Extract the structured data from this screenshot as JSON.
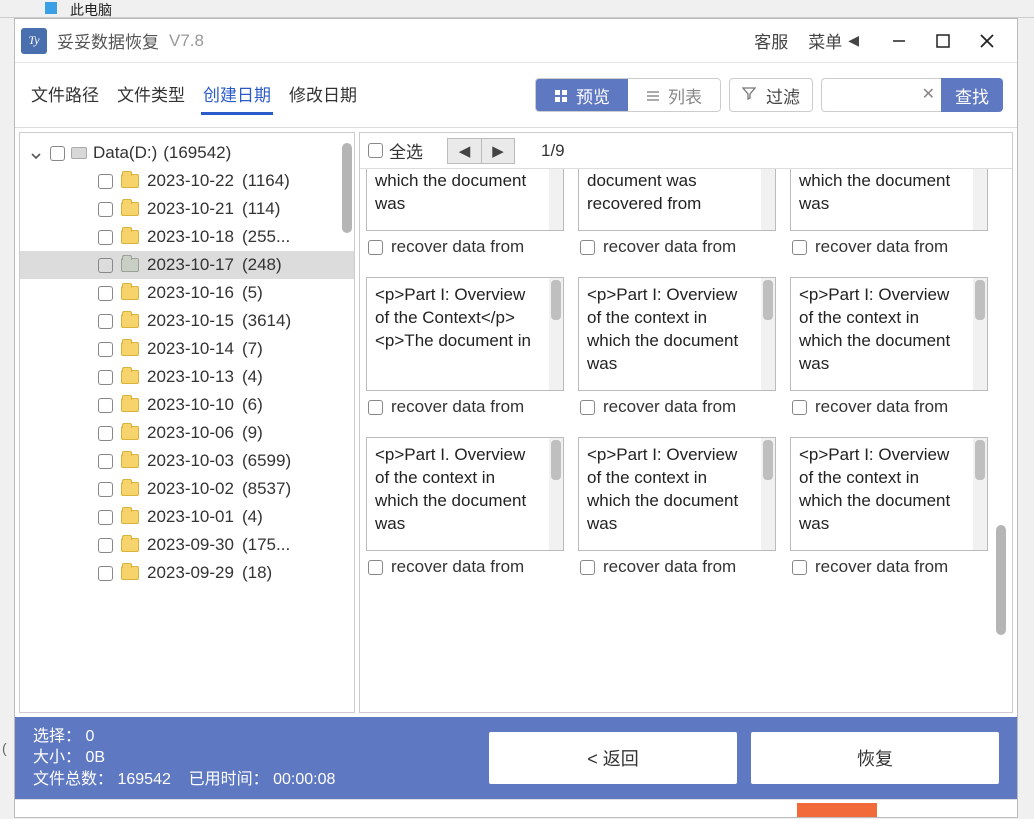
{
  "topfrag": {
    "label": "此电脑"
  },
  "title": {
    "app": "妥妥数据恢复",
    "version": "V7.8",
    "support": "客服",
    "menu": "菜单"
  },
  "tabs": {
    "path": "文件路径",
    "type": "文件类型",
    "created": "创建日期",
    "modified": "修改日期"
  },
  "view": {
    "preview": "预览",
    "list": "列表",
    "filter": "过滤",
    "search": "查找"
  },
  "tree": {
    "root_name": "Data(D:)",
    "root_count": "(169542)",
    "items": [
      {
        "name": "2023-10-22",
        "count": "(1164)"
      },
      {
        "name": "2023-10-21",
        "count": "(114)"
      },
      {
        "name": "2023-10-18",
        "count": "(255..."
      },
      {
        "name": "2023-10-17",
        "count": "(248)",
        "selected": true
      },
      {
        "name": "2023-10-16",
        "count": "(5)"
      },
      {
        "name": "2023-10-15",
        "count": "(3614)"
      },
      {
        "name": "2023-10-14",
        "count": "(7)"
      },
      {
        "name": "2023-10-13",
        "count": "(4)"
      },
      {
        "name": "2023-10-10",
        "count": "(6)"
      },
      {
        "name": "2023-10-06",
        "count": "(9)"
      },
      {
        "name": "2023-10-03",
        "count": "(6599)"
      },
      {
        "name": "2023-10-02",
        "count": "(8537)"
      },
      {
        "name": "2023-10-01",
        "count": "(4)"
      },
      {
        "name": "2023-09-30",
        "count": "(175..."
      },
      {
        "name": "2023-09-29",
        "count": "(18)"
      }
    ]
  },
  "preview": {
    "select_all": "全选",
    "page": "1/9",
    "items": [
      {
        "text": "<p>Part I: Overview of the context in which the document was",
        "label": "recover data from"
      },
      {
        "text": "<p>Part I: Overview</p><p>The document was recovered from",
        "label": "recover data from"
      },
      {
        "text": "<p>Part I: Overview of the context in which the document was",
        "label": "recover data from"
      },
      {
        "text": "<p>Part I: Overview of the Context</p><p>The document in",
        "label": "recover data from"
      },
      {
        "text": "<p>Part I: Overview of the context in which the document was",
        "label": "recover data from"
      },
      {
        "text": "<p>Part I: Overview of the context in which the document was",
        "label": "recover data from"
      },
      {
        "text": "<p>Part I. Overview of the context in which the document was",
        "label": "recover data from"
      },
      {
        "text": "<p>Part I: Overview of the context in which the document was",
        "label": "recover data from"
      },
      {
        "text": "<p>Part I: Overview of the context in which the document was",
        "label": "recover data from"
      }
    ]
  },
  "status": {
    "selected_label": "选择：",
    "selected_value": "0",
    "size_label": "大小：",
    "size_value": "0B",
    "total_label": "文件总数：",
    "total_value": "169542",
    "elapsed_label": "已用时间：",
    "elapsed_value": "00:00:08",
    "back": "< 返回",
    "recover": "恢复"
  }
}
